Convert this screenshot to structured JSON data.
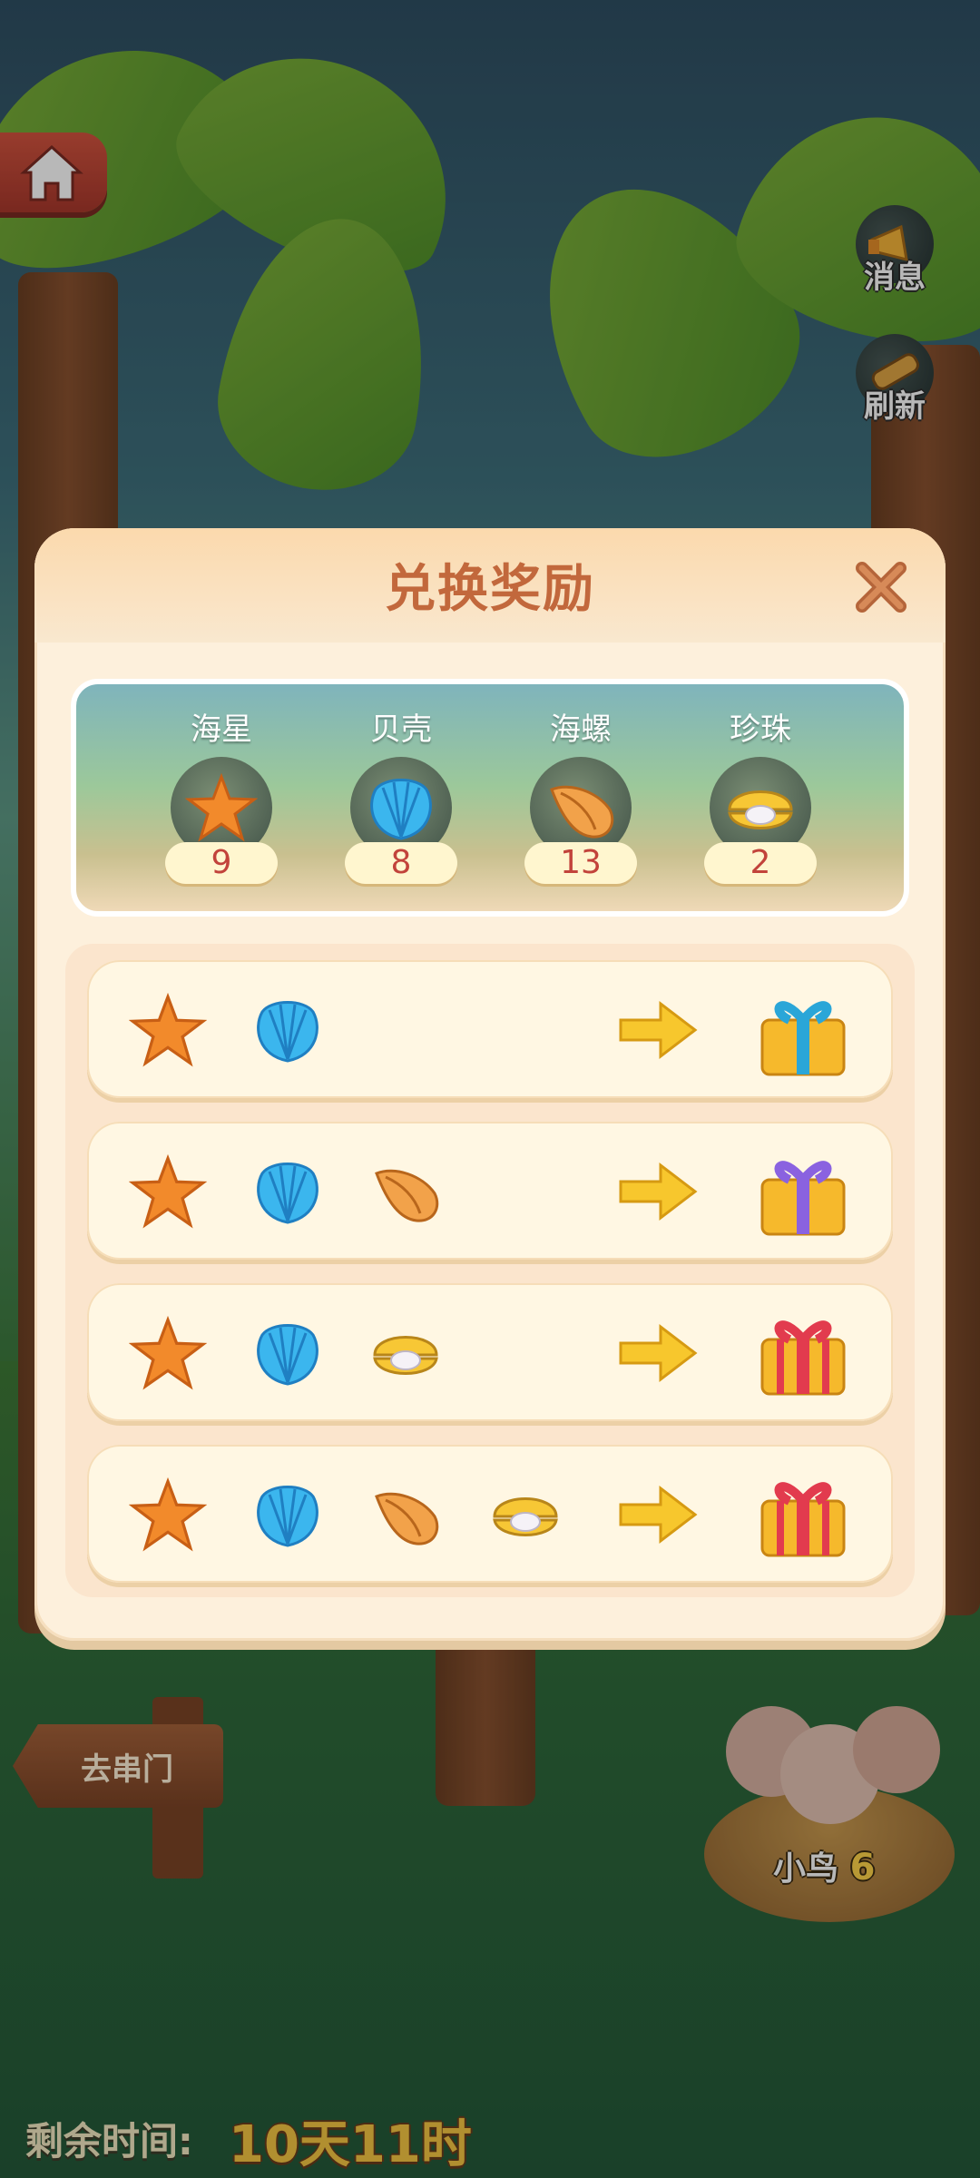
{
  "header": {
    "title": "兑换奖励"
  },
  "side_buttons": {
    "message": "消息",
    "refresh": "刷新"
  },
  "inventory": [
    {
      "label": "海星",
      "count": "9",
      "icon": "starfish-icon"
    },
    {
      "label": "贝壳",
      "count": "8",
      "icon": "shell-icon"
    },
    {
      "label": "海螺",
      "count": "13",
      "icon": "conch-icon"
    },
    {
      "label": "珍珠",
      "count": "2",
      "icon": "pearl-icon"
    }
  ],
  "recipes": [
    {
      "inputs": [
        "starfish-icon",
        "shell-icon"
      ],
      "reward": "gift-blue-icon"
    },
    {
      "inputs": [
        "starfish-icon",
        "shell-icon",
        "conch-icon"
      ],
      "reward": "gift-purple-icon"
    },
    {
      "inputs": [
        "starfish-icon",
        "shell-icon",
        "pearl-icon"
      ],
      "reward": "gift-red-icon"
    },
    {
      "inputs": [
        "starfish-icon",
        "shell-icon",
        "conch-icon",
        "pearl-icon"
      ],
      "reward": "gift-red-icon"
    }
  ],
  "signpost": {
    "label": "去串门"
  },
  "nest": {
    "label": "小鸟",
    "count": "6"
  },
  "timer": {
    "label": "剩余时间:",
    "value": "10天11时"
  },
  "colors": {
    "title": "#c2683c",
    "count": "#c2433b",
    "timer_value": "#f5c643"
  }
}
